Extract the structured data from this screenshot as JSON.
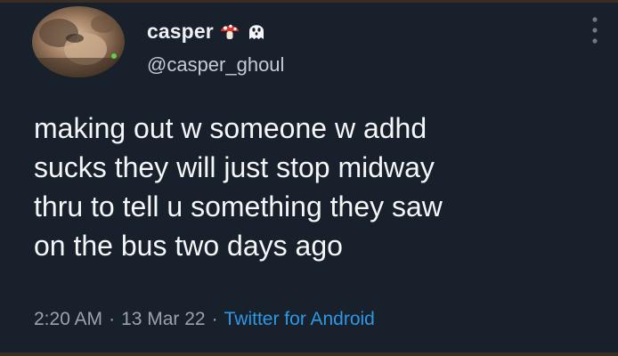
{
  "tweet": {
    "author": {
      "display_name": "casper",
      "name_emojis": [
        "mushroom-icon",
        "ghost-icon"
      ],
      "handle": "@casper_ghoul"
    },
    "text_lines": [
      "making out w someone w adhd",
      "sucks they will just stop midway",
      "thru to tell u something they saw",
      "on the bus two days ago"
    ],
    "time": "2:20 AM",
    "separator": "·",
    "date": "13 Mar 22",
    "source": "Twitter for Android"
  },
  "colors": {
    "background": "#18202b",
    "text_primary": "#f4f6f8",
    "text_secondary": "#9aa3ad",
    "link": "#2d98e6"
  }
}
